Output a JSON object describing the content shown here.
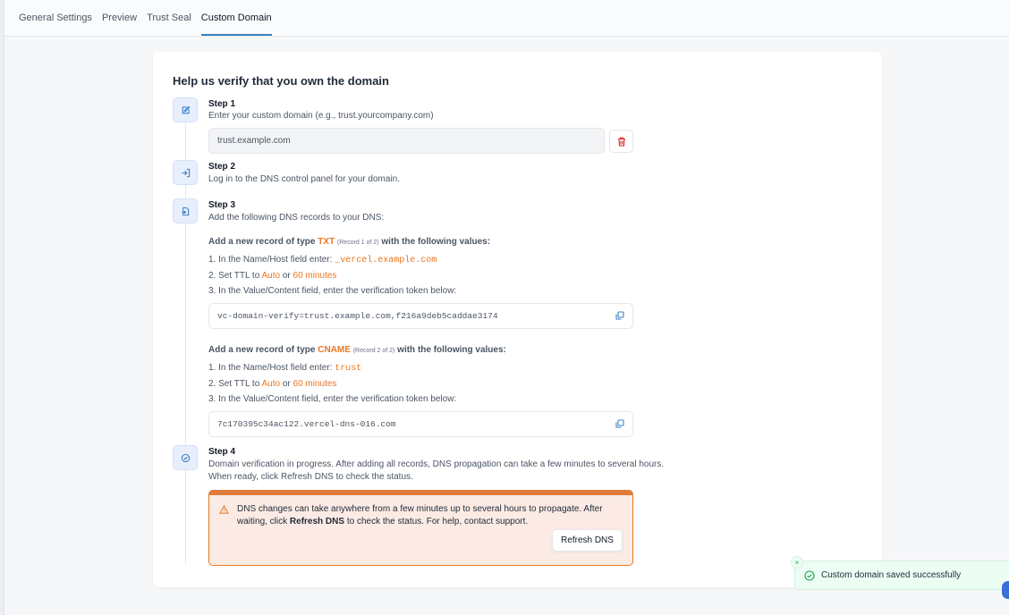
{
  "tabs": [
    {
      "label": "General Settings"
    },
    {
      "label": "Preview"
    },
    {
      "label": "Trust Seal"
    },
    {
      "label": "Custom Domain",
      "active": true
    }
  ],
  "card": {
    "title": "Help us verify that you own the domain"
  },
  "steps": [
    {
      "title": "Step 1",
      "desc": "Enter your custom domain (e.g., trust.yourcompany.com)",
      "icon": "edit-icon"
    },
    {
      "title": "Step 2",
      "desc": "Log in to the DNS control panel for your domain.",
      "icon": "login-icon"
    },
    {
      "title": "Step 3",
      "desc": "Add the following DNS records to your DNS:",
      "icon": "file-import-icon"
    },
    {
      "title": "Step 4",
      "desc": "Domain verification in progress. After adding all records, DNS propagation can take a few minutes to several hours.",
      "desc2": "When ready, click Refresh DNS to check the status.",
      "icon": "clock-check-icon"
    }
  ],
  "domain_input": {
    "value": "trust.example.com"
  },
  "records": [
    {
      "head_prefix": "Add a new record of type ",
      "type": "TXT",
      "count": "(Record 1 of 2)",
      "head_suffix": " with the following values:",
      "line1_prefix": "1. In the Name/Host field enter: ",
      "host": "_vercel.example.com",
      "line2_prefix": "2. Set TTL to ",
      "ttl_auto": "Auto",
      "ttl_or": " or ",
      "ttl_minutes": "60 minutes",
      "line3": "3. In the Value/Content field, enter the verification token below:",
      "token": "vc-domain-verify=trust.example.com,f216a9deb5caddae3174"
    },
    {
      "head_prefix": "Add a new record of type ",
      "type": "CNAME",
      "count": "(Record 2 of 2)",
      "head_suffix": " with the following values:",
      "line1_prefix": "1. In the Name/Host field enter: ",
      "host": "trust",
      "line2_prefix": "2. Set TTL to ",
      "ttl_auto": "Auto",
      "ttl_or": " or ",
      "ttl_minutes": "60 minutes",
      "line3": "3. In the Value/Content field, enter the verification token below:",
      "token": "7c170395c34ac122.vercel-dns-016.com"
    }
  ],
  "warning": {
    "text_before": "DNS changes can take anywhere from a few minutes up to several hours to propagate. After waiting, click ",
    "text_bold": "Refresh DNS",
    "text_after": " to check the status. For help, contact support.",
    "button": "Refresh DNS"
  },
  "toast": {
    "message": "Custom domain saved successfully",
    "close": "×"
  },
  "colors": {
    "accent": "#3b82c4",
    "orange": "#e87722",
    "success": "#16a34a",
    "danger": "#dc2626"
  }
}
